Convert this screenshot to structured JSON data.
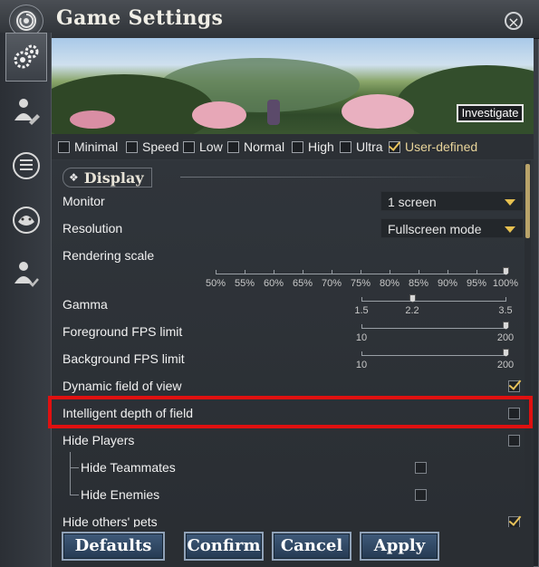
{
  "window": {
    "title": "Game Settings",
    "close_label": "×"
  },
  "sidebar": {
    "items": [
      {
        "icon": "gear-cluster-icon",
        "active": true
      },
      {
        "icon": "character-edit-icon",
        "active": false
      },
      {
        "icon": "document-list-icon",
        "active": false
      },
      {
        "icon": "tiger-head-icon",
        "active": false
      },
      {
        "icon": "character-check-icon",
        "active": false
      }
    ]
  },
  "banner": {
    "investigate_label": "Investigate"
  },
  "presets": [
    {
      "label": "Minimal",
      "checked": false
    },
    {
      "label": "Speed",
      "checked": false
    },
    {
      "label": "Low",
      "checked": false
    },
    {
      "label": "Normal",
      "checked": false
    },
    {
      "label": "High",
      "checked": false
    },
    {
      "label": "Ultra",
      "checked": false
    },
    {
      "label": "User-defined",
      "checked": true
    }
  ],
  "display": {
    "section_title": "Display",
    "monitor": {
      "label": "Monitor",
      "value": "1 screen"
    },
    "resolution": {
      "label": "Resolution",
      "value": "Fullscreen mode"
    },
    "rendering_scale": {
      "label": "Rendering scale",
      "ticks": [
        "50%",
        "55%",
        "60%",
        "65%",
        "70%",
        "75%",
        "80%",
        "85%",
        "90%",
        "95%",
        "100%"
      ],
      "value": "100%"
    },
    "gamma": {
      "label": "Gamma",
      "min": "1.5",
      "value": "2.2",
      "max": "3.5"
    },
    "fg_fps": {
      "label": "Foreground FPS limit",
      "min": "10",
      "max": "200",
      "value": 200
    },
    "bg_fps": {
      "label": "Background FPS limit",
      "min": "10",
      "max": "200",
      "value": 200
    },
    "dynamic_fov": {
      "label": "Dynamic field of view",
      "checked": true
    },
    "intelligent_dof": {
      "label": "Intelligent depth of field",
      "checked": false
    },
    "hide_players": {
      "label": "Hide Players",
      "checked": false
    },
    "hide_teammates": {
      "label": "Hide Teammates",
      "checked": false
    },
    "hide_enemies": {
      "label": "Hide Enemies",
      "checked": false
    },
    "hide_pets": {
      "label": "Hide others' pets",
      "checked": true
    }
  },
  "footer": {
    "defaults": "Defaults",
    "confirm": "Confirm",
    "cancel": "Cancel",
    "apply": "Apply"
  },
  "colors": {
    "accent": "#e8c25a",
    "highlight": "#e01010",
    "button": "#3f5a7a"
  }
}
